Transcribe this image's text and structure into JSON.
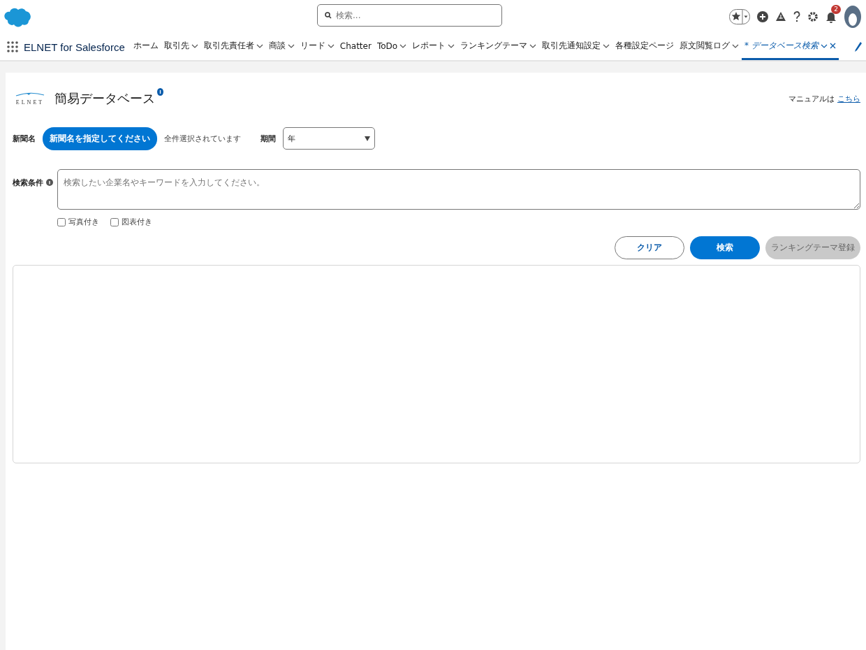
{
  "header": {
    "search": {
      "placeholder": "検索..."
    },
    "notifications": {
      "count": "2"
    }
  },
  "nav": {
    "app_name": "ELNET for Salesforce",
    "tabs": [
      {
        "label": "ホーム",
        "has_menu": false,
        "selected": false,
        "closable": false
      },
      {
        "label": "取引先",
        "has_menu": true,
        "selected": false,
        "closable": false
      },
      {
        "label": "取引先責任者",
        "has_menu": true,
        "selected": false,
        "closable": false
      },
      {
        "label": "商談",
        "has_menu": true,
        "selected": false,
        "closable": false
      },
      {
        "label": "リード",
        "has_menu": true,
        "selected": false,
        "closable": false
      },
      {
        "label": "Chatter",
        "has_menu": false,
        "selected": false,
        "closable": false
      },
      {
        "label": "ToDo",
        "has_menu": true,
        "selected": false,
        "closable": false
      },
      {
        "label": "レポート",
        "has_menu": true,
        "selected": false,
        "closable": false
      },
      {
        "label": "ランキングテーマ",
        "has_menu": true,
        "selected": false,
        "closable": false
      },
      {
        "label": "取引先通知設定",
        "has_menu": true,
        "selected": false,
        "closable": false
      },
      {
        "label": "各種設定ページ",
        "has_menu": false,
        "selected": false,
        "closable": false
      },
      {
        "label": "原文閲覧ログ",
        "has_menu": true,
        "selected": false,
        "closable": false
      },
      {
        "label": "* データベース検索",
        "has_menu": true,
        "selected": true,
        "closable": true
      }
    ]
  },
  "page": {
    "logo_text": "ELNET",
    "title": "簡易データベース",
    "manual_label": "マニュアルは",
    "manual_link": "こちら",
    "newspaper": {
      "label": "新聞名",
      "button": "新聞名を指定してください",
      "status": "全件選択されています"
    },
    "period": {
      "label": "期間",
      "value": "年"
    },
    "conditions": {
      "label": "検索条件",
      "placeholder": "検索したい企業名やキーワードを入力してください。"
    },
    "options": [
      {
        "label": "写真付き",
        "checked": false
      },
      {
        "label": "図表付き",
        "checked": false
      }
    ],
    "buttons": [
      {
        "label": "クリア",
        "kind": "outline",
        "disabled": false
      },
      {
        "label": "検索",
        "kind": "primary",
        "disabled": false
      },
      {
        "label": "ランキングテーマ登録",
        "kind": "primary",
        "disabled": true
      }
    ]
  }
}
